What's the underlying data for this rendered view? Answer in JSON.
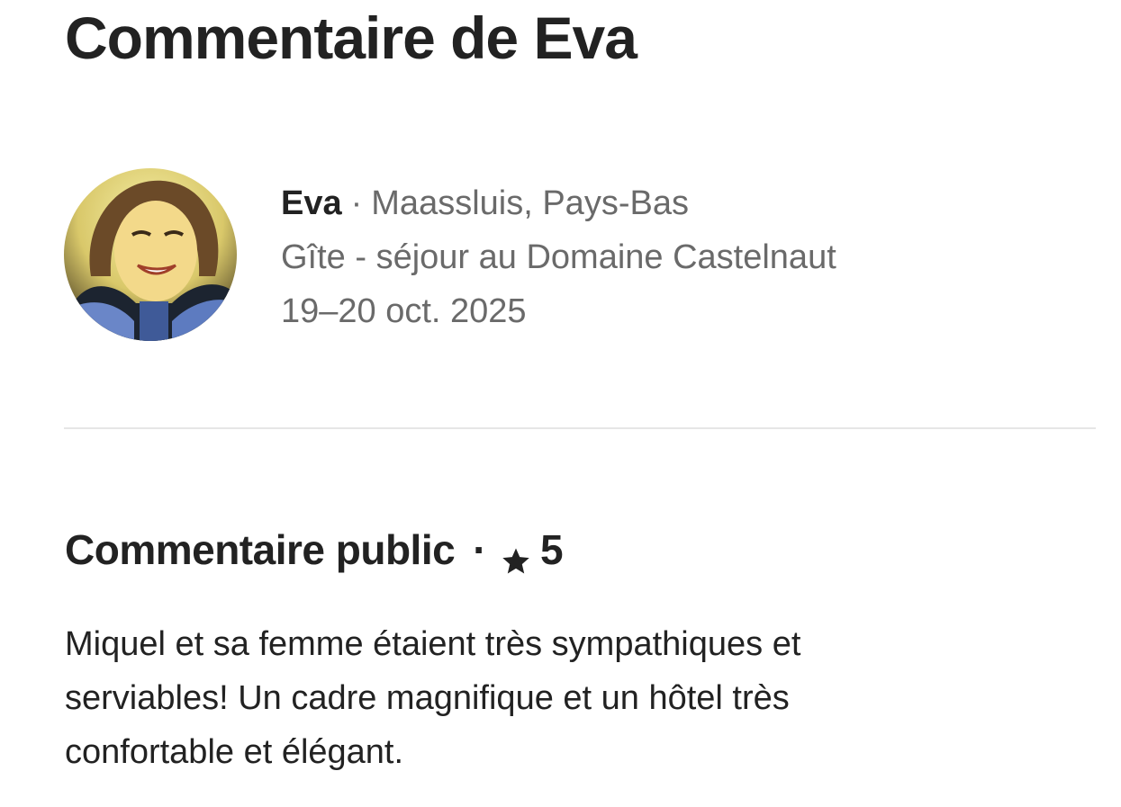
{
  "page": {
    "title": "Commentaire de Eva"
  },
  "reviewer": {
    "name": "Eva",
    "separator": "·",
    "location": "Maassluis, Pays-Bas",
    "stay": "Gîte - séjour au Domaine Castelnaut",
    "dates": "19–20 oct. 2025",
    "avatar_icon": "avatar-photo"
  },
  "public_review": {
    "heading": "Commentaire public",
    "separator": "·",
    "rating_icon": "star-icon",
    "rating": "5",
    "text": "Miquel et sa femme étaient très sympathiques et serviables! Un cadre magnifique et un hôtel très confortable et élégant."
  },
  "colors": {
    "primary_text": "#222222",
    "secondary_text": "#6a6a6a",
    "divider": "#e6e6e6"
  }
}
